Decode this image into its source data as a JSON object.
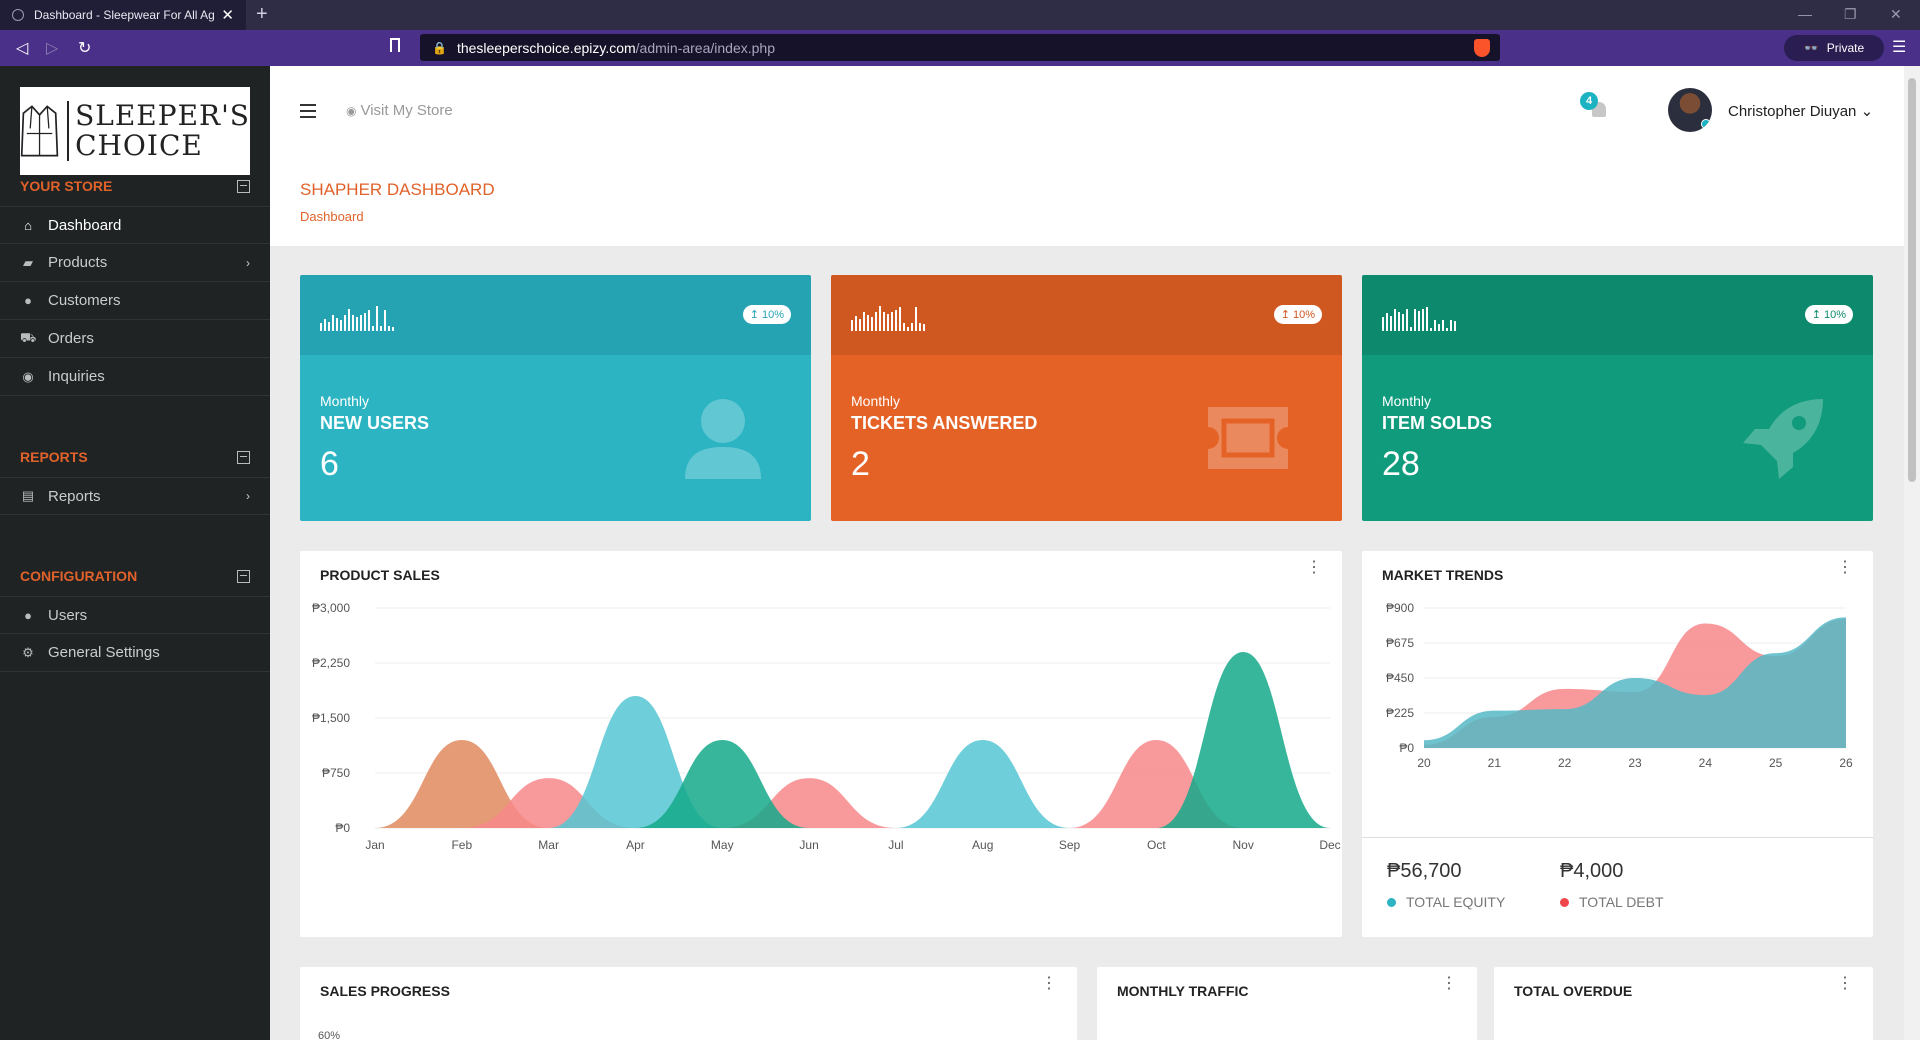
{
  "browser": {
    "tab_title": "Dashboard - Sleepwear For All Ag",
    "url_domain": "thesleeperschoice.epizy.com",
    "url_path": "/admin-area/index.php",
    "private_label": "Private"
  },
  "sidebar": {
    "logo_text_line1": "SLEEPER'S",
    "logo_text_line2": "CHOICE",
    "store_section": "YOUR STORE",
    "store_items": [
      {
        "label": "Dashboard",
        "icon": "home-icon"
      },
      {
        "label": "Products",
        "icon": "bag-icon"
      },
      {
        "label": "Customers",
        "icon": "users-icon"
      },
      {
        "label": "Orders",
        "icon": "cart-icon"
      },
      {
        "label": "Inquiries",
        "icon": "chat-icon"
      }
    ],
    "reports_section": "REPORTS",
    "reports_items": [
      {
        "label": "Reports",
        "icon": "file-icon"
      }
    ],
    "config_section": "CONFIGURATION",
    "config_items": [
      {
        "label": "Users",
        "icon": "users-icon"
      },
      {
        "label": "General Settings",
        "icon": "cogs-icon"
      }
    ]
  },
  "header": {
    "visit_store": "Visit My Store",
    "notification_count": "4",
    "user_name": "Christopher Diuyan"
  },
  "page": {
    "title": "SHAPHER DASHBOARD",
    "breadcrumb": "Dashboard"
  },
  "stats": [
    {
      "label": "Monthly",
      "title": "NEW USERS",
      "value": "6",
      "change": "10%",
      "color_top": "#26a3b3",
      "color_bottom": "#2cb4c3",
      "icon": "user-icon"
    },
    {
      "label": "Monthly",
      "title": "TICKETS ANSWERED",
      "value": "2",
      "change": "10%",
      "color_top": "#cf5720",
      "color_bottom": "#e46226",
      "icon": "ticket-icon"
    },
    {
      "label": "Monthly",
      "title": "ITEM SOLDS",
      "value": "28",
      "change": "10%",
      "color_top": "#0d8a6e",
      "color_bottom": "#0f9b7c",
      "icon": "rocket-icon"
    }
  ],
  "product_sales": {
    "title": "PRODUCT SALES",
    "chart_data": {
      "type": "area",
      "categories": [
        "Jan",
        "Feb",
        "Mar",
        "Apr",
        "May",
        "Jun",
        "Jul",
        "Aug",
        "Sep",
        "Oct",
        "Nov",
        "Dec"
      ],
      "ytick_labels": [
        "₱0",
        "₱750",
        "₱1,500",
        "₱2,250",
        "₱3,000"
      ],
      "ylim": [
        0,
        3000
      ],
      "series": [
        {
          "color": "#e08a5e",
          "peaks": [
            {
              "x": "Feb",
              "y": 1200
            }
          ]
        },
        {
          "color": "#f7888a",
          "peaks": [
            {
              "x": "Mar",
              "y": 680
            },
            {
              "x": "Jun",
              "y": 680
            },
            {
              "x": "Oct",
              "y": 1200
            }
          ]
        },
        {
          "color": "#55c6d2",
          "peaks": [
            {
              "x": "Apr",
              "y": 1800
            },
            {
              "x": "Aug",
              "y": 1200
            }
          ]
        },
        {
          "color": "#14a98a",
          "peaks": [
            {
              "x": "May",
              "y": 1200
            },
            {
              "x": "Nov",
              "y": 2400
            }
          ]
        }
      ]
    }
  },
  "market_trends": {
    "title": "MARKET TRENDS",
    "chart_data": {
      "type": "area",
      "x": [
        "20",
        "21",
        "22",
        "23",
        "24",
        "25",
        "26"
      ],
      "ytick_labels": [
        "₱0",
        "₱225",
        "₱450",
        "₱675",
        "₱900"
      ],
      "ylim": [
        0,
        900
      ],
      "series": [
        {
          "color": "#f7888a",
          "values": [
            20,
            200,
            380,
            360,
            800,
            590,
            830
          ]
        },
        {
          "color": "#55b8c6",
          "values": [
            50,
            240,
            250,
            450,
            340,
            610,
            840
          ]
        }
      ]
    },
    "equity_value": "₱56,700",
    "equity_label": "TOTAL EQUITY",
    "equity_color": "#2cb4c3",
    "debt_value": "₱4,000",
    "debt_label": "TOTAL DEBT",
    "debt_color": "#f0464b"
  },
  "bottom_panels": {
    "sales_progress": "SALES PROGRESS",
    "sales_progress_tick": "60%",
    "monthly_traffic": "MONTHLY TRAFFIC",
    "total_overdue": "TOTAL OVERDUE"
  }
}
